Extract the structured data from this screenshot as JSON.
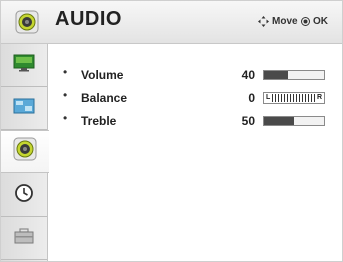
{
  "header": {
    "title": "AUDIO",
    "icon": "speaker-icon",
    "hints": [
      {
        "icon": "move-arrows-icon",
        "label": "Move"
      },
      {
        "icon": "ok-button-icon",
        "label": "OK"
      }
    ]
  },
  "sidebar": {
    "items": [
      {
        "name": "picture",
        "icon": "tv-screen-icon",
        "active": false
      },
      {
        "name": "option",
        "icon": "screen-settings-icon",
        "active": false
      },
      {
        "name": "audio",
        "icon": "speaker-icon",
        "active": true
      },
      {
        "name": "time",
        "icon": "clock-icon",
        "active": false
      },
      {
        "name": "setup",
        "icon": "toolbox-icon",
        "active": false
      }
    ]
  },
  "settings": [
    {
      "bullet": "•",
      "label": "Volume",
      "value": "40",
      "level": 0.4
    },
    {
      "bullet": "•",
      "label": "Balance",
      "value": "0",
      "left_letter": "L",
      "right_letter": "R"
    },
    {
      "bullet": "•",
      "label": "Treble",
      "value": "50",
      "level": 0.5
    }
  ],
  "colors": {
    "bar_fill": "#4a4a4a",
    "speaker_green": "#b8cc2a"
  }
}
